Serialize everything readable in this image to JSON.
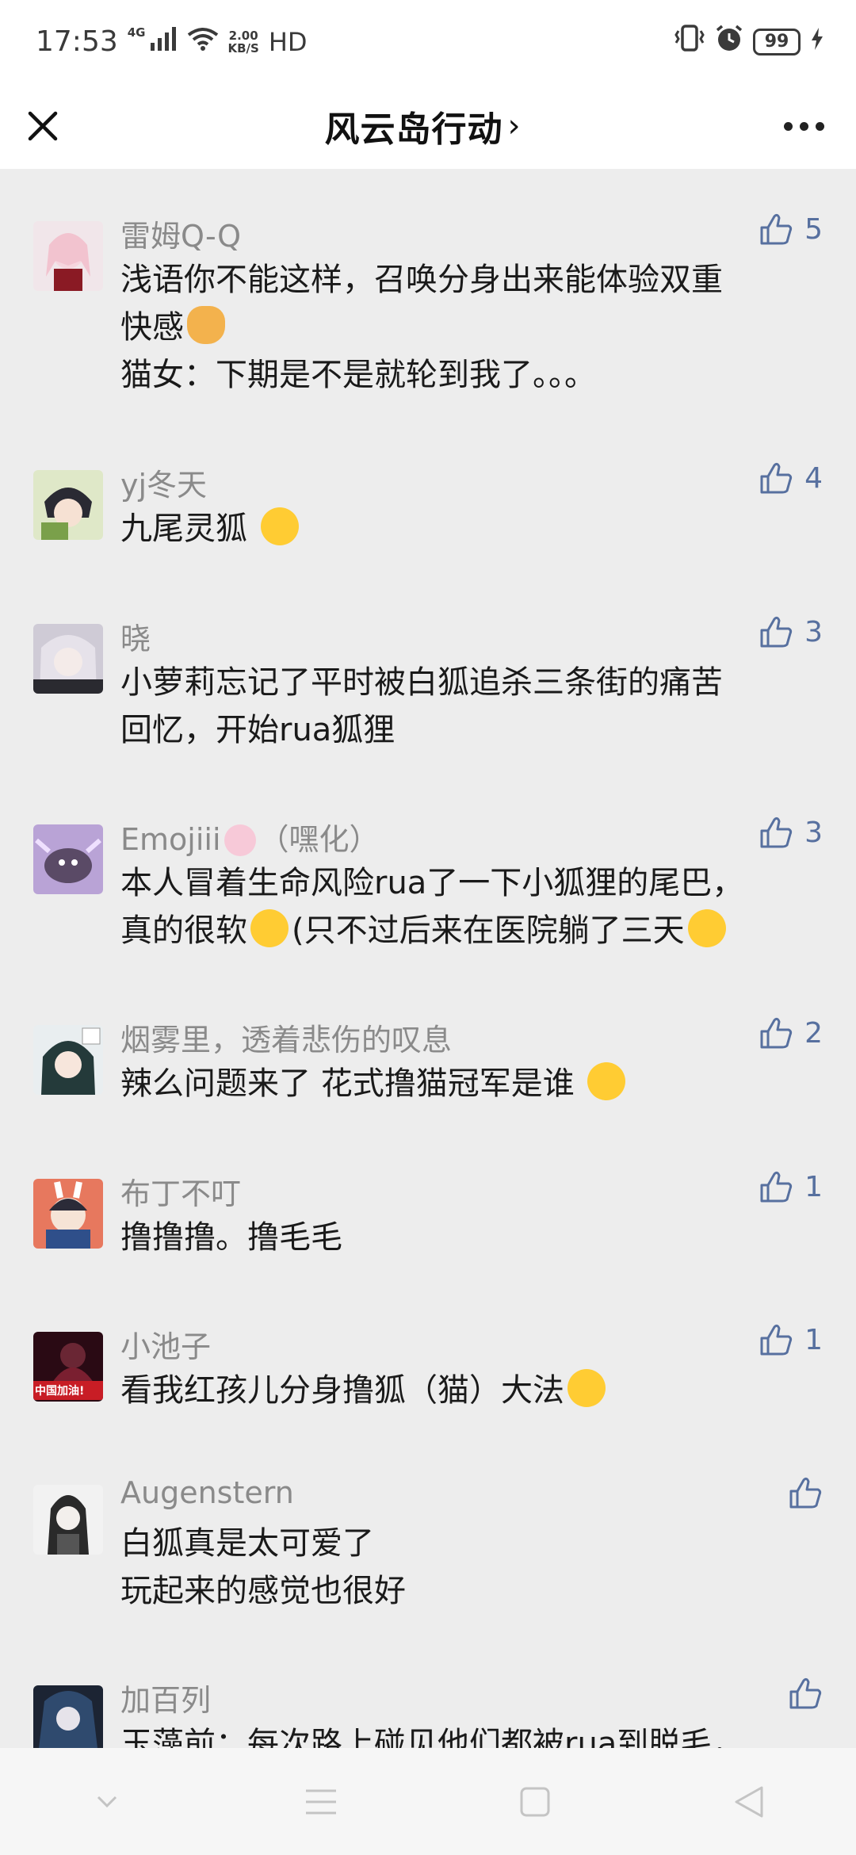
{
  "status_bar": {
    "time": "17:53",
    "signal_label": "4G",
    "speed_value": "2.00",
    "speed_unit": "KB/S",
    "hd": "HD",
    "battery": "99"
  },
  "nav": {
    "title": "风云岛行动",
    "chevron": "›"
  },
  "comments": [
    {
      "name": "雷姆Q-Q",
      "likes": "5",
      "lines": [
        "浅语你不能这样，召唤分身出来能体验双重",
        "快感",
        "猫女：下期是不是就轮到我了。。。"
      ]
    },
    {
      "name": "yj冬天",
      "likes": "4",
      "lines": [
        "九尾灵狐"
      ]
    },
    {
      "name": "晓",
      "likes": "3",
      "lines": [
        "小萝莉忘记了平时被白狐追杀三条街的痛苦",
        "回忆，开始rua狐狸"
      ]
    },
    {
      "name": "Emojiii",
      "name_suffix": "（嘿化）",
      "likes": "3",
      "lines": [
        "本人冒着生命风险rua了一下小狐狸的尾巴，",
        "真的很软",
        "(只不过后来在医院躺了三天"
      ]
    },
    {
      "name": "烟雾里，透着悲伤的叹息",
      "likes": "2",
      "lines": [
        "辣么问题来了 花式撸猫冠军是谁"
      ]
    },
    {
      "name": "布丁不叮",
      "likes": "1",
      "lines": [
        "撸撸撸。撸毛毛"
      ]
    },
    {
      "name": "小池子",
      "likes": "1",
      "avatar_text": "中国加油!",
      "lines": [
        "看我红孩儿分身撸狐（猫）大法"
      ]
    },
    {
      "name": "Augenstern",
      "likes": "",
      "lines": [
        "白狐真是太可爱了",
        "玩起来的感觉也很好"
      ]
    },
    {
      "name": "加百列",
      "likes": "",
      "lines": [
        "玉藻前：每次路上碰见他们都被rua到脱毛，"
      ]
    }
  ],
  "icons": {
    "close": "close-icon",
    "more": "more-icon",
    "like": "thumbs-up-icon"
  },
  "colors": {
    "background": "#ededed",
    "like_blue": "#57709f",
    "name_gray": "#8a8a8a"
  }
}
